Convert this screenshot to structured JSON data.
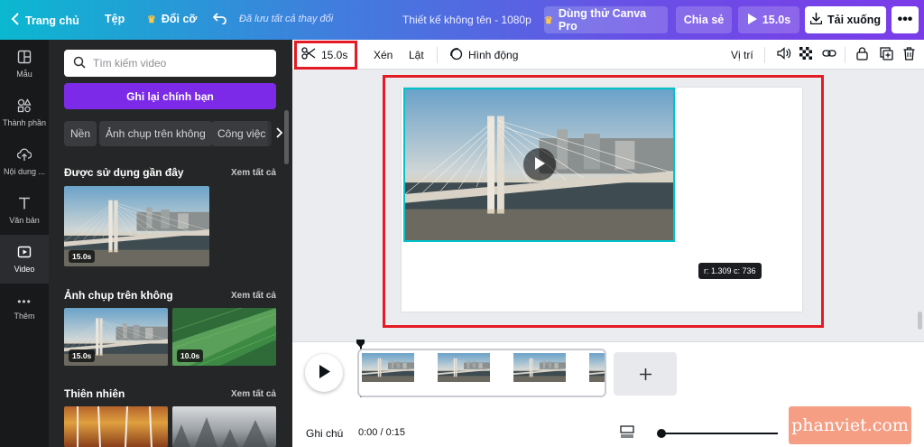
{
  "topbar": {
    "home": "Trang chủ",
    "file": "Tệp",
    "resize": "Đổi cỡ",
    "saved_status": "Đã lưu tất cả thay đổi",
    "design_title": "Thiết kế không tên - 1080p",
    "pro_trial": "Dùng thử Canva Pro",
    "share": "Chia sẻ",
    "play_duration": "15.0s",
    "download": "Tải xuống"
  },
  "rail": {
    "templates": "Mẫu",
    "elements": "Thành phần",
    "uploads": "Nội dung ...",
    "text": "Văn bản",
    "video": "Video",
    "more": "Thêm"
  },
  "panel": {
    "search_placeholder": "Tìm kiếm video",
    "record_button": "Ghi lại chính bạn",
    "chips": [
      "Nền",
      "Ảnh chụp trên không",
      "Công việc"
    ],
    "recent_title": "Được sử dụng gần đây",
    "aerial_title": "Ảnh chụp trên không",
    "nature_title": "Thiên nhiên",
    "see_all": "Xem tất cả",
    "recent_duration": "15.0s",
    "aerial_durations": [
      "15.0s",
      "10.0s"
    ]
  },
  "toolbar": {
    "trim_duration": "15.0s",
    "crop": "Xén",
    "flip": "Lật",
    "animate": "Hình động",
    "position": "Vị trí"
  },
  "canvas": {
    "tooltip": "r: 1.309 c: 736"
  },
  "timeline": {
    "notes": "Ghi chú",
    "time": "0:00 / 0:15"
  },
  "watermark": "phanviet.com",
  "colors": {
    "accent_purple": "#7d2ae8",
    "selection_cyan": "#00c4cc",
    "highlight_red": "#e41b25"
  }
}
